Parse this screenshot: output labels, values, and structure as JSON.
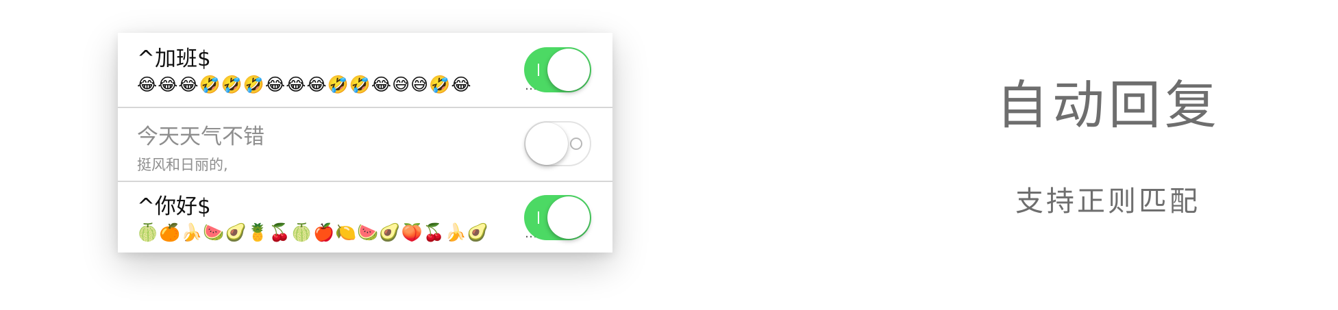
{
  "rules": [
    {
      "pattern": "^加班$",
      "reply": "😂😂😂🤣🤣🤣😂😂😂🤣🤣😂😅😅🤣😂",
      "truncated": "…",
      "enabled": true
    },
    {
      "pattern": "今天天气不错",
      "reply": "挺风和日丽的,",
      "truncated": "",
      "enabled": false
    },
    {
      "pattern": "^你好$",
      "reply": "🍈🍊🍌🍉🥑🍍🍒🍈🍎🍋🍉🥑🍑🍒🍌🥑",
      "truncated": "…",
      "enabled": true
    }
  ],
  "feature": {
    "title": "自动回复",
    "subtitle": "支持正则匹配"
  },
  "colors": {
    "toggle_on": "#4cd964",
    "toggle_off_border": "#e3e3e3",
    "headline_text": "#6e6e6e",
    "disabled_text": "#8e8e8e"
  }
}
